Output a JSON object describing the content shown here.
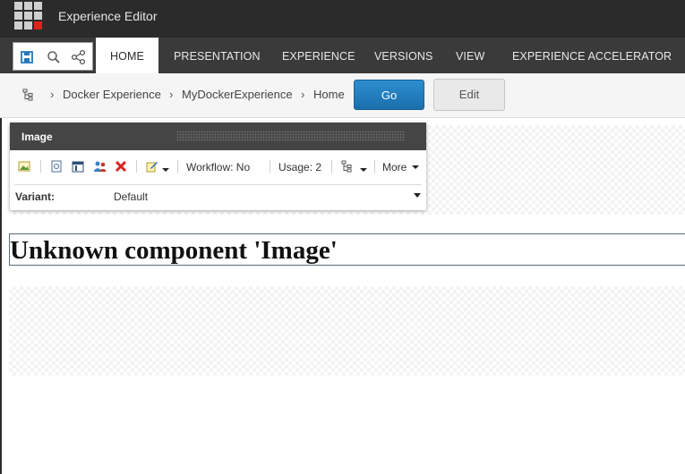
{
  "app": {
    "title": "Experience Editor"
  },
  "ribbon": {
    "tabs": [
      {
        "label": "HOME",
        "active": true
      },
      {
        "label": "PRESENTATION"
      },
      {
        "label": "EXPERIENCE"
      },
      {
        "label": "VERSIONS"
      },
      {
        "label": "VIEW"
      },
      {
        "label": "EXPERIENCE ACCELERATOR"
      }
    ],
    "quick_access_icons": [
      "save-icon",
      "search-icon",
      "share-icon"
    ]
  },
  "breadcrumb": {
    "items": [
      "Docker Experience",
      "MyDockerExperience",
      "Home"
    ],
    "go_label": "Go",
    "edit_label": "Edit"
  },
  "chrome": {
    "title": "Image",
    "workflow": "Workflow: No",
    "usage": "Usage: 2",
    "more_label": "More",
    "variant_label": "Variant:",
    "variant_value": "Default"
  },
  "content": {
    "unknown_component": "Unknown component 'Image'"
  },
  "colors": {
    "appbar": "#2b2b2b",
    "tabstrip": "#3a3a3a",
    "go_button": "#1f7cbf",
    "remove": "#d9231e"
  }
}
